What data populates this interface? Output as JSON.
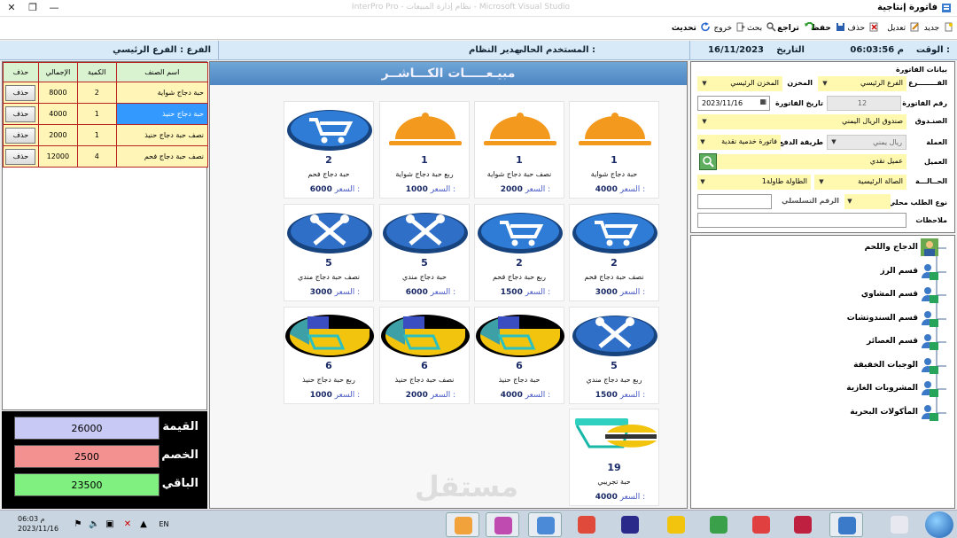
{
  "window": {
    "title": "فاتورة إنتاجية",
    "background_title": "InterPro Pro - نظام إدارة المبيعات - Microsoft Visual Studio",
    "controls": [
      "✕",
      "❐",
      "—"
    ]
  },
  "toolbar": {
    "items": [
      {
        "label": "جديد",
        "icon": "new-icon"
      },
      {
        "label": "تعديل",
        "icon": "edit-icon"
      },
      {
        "label": "حذف",
        "icon": "delete-icon"
      },
      {
        "label": "حفظ",
        "icon": "save-icon"
      },
      {
        "label": "تراجع",
        "icon": "undo-icon"
      },
      {
        "label": "بحث",
        "icon": "search-icon"
      },
      {
        "label": "خروج",
        "icon": "exit-icon"
      },
      {
        "label": "تحديث",
        "icon": "refresh-icon"
      }
    ]
  },
  "infobar": {
    "time_label": "الوقت :",
    "time_value": "06:03:56 م",
    "date_label": "التاريخ",
    "date_value": "16/11/2023",
    "user_label": "المستخدم الحالي :",
    "user_value": "مدير النظام",
    "branch_label": "الفرع :",
    "branch_value": "الفرع الرئيسي"
  },
  "cart": {
    "columns": {
      "name": "اسم الصنف",
      "qty": "الكمية",
      "total": "الإجمالي",
      "delete": "حذف"
    },
    "rows": [
      {
        "name": "حبة دجاج شواية",
        "qty": "2",
        "total": "8000",
        "delete": "حذف",
        "selected": false
      },
      {
        "name": "حبة دجاج حنيذ",
        "qty": "1",
        "total": "4000",
        "delete": "حذف",
        "selected": true
      },
      {
        "name": "نصف حبة دجاج حنيذ",
        "qty": "1",
        "total": "2000",
        "delete": "حذف",
        "selected": false
      },
      {
        "name": "نصف حبة دجاج فحم",
        "qty": "4",
        "total": "12000",
        "delete": "حذف",
        "selected": false
      }
    ]
  },
  "totals": {
    "value_label": "القيمة",
    "value": "26000",
    "discount_label": "الخصم",
    "discount": "2500",
    "remaining_label": "الباقي",
    "remaining": "23500",
    "colors": {
      "value": "#c9c9f6",
      "discount": "#f39090",
      "remaining": "#80f080"
    }
  },
  "sales": {
    "header": "مبيـعـــــات الكـــاشــر",
    "price_label": "السعر :",
    "items": [
      {
        "count": "1",
        "name": "حبة دجاج شواية",
        "price": "4000",
        "icon": "serving-dish-icon"
      },
      {
        "count": "1",
        "name": "نصف حبة دجاج شواية",
        "price": "2000",
        "icon": "serving-dish-icon"
      },
      {
        "count": "1",
        "name": "ربع حبة دجاج شواية",
        "price": "1000",
        "icon": "serving-dish-icon"
      },
      {
        "count": "2",
        "name": "حبة دجاج فحم",
        "price": "6000",
        "icon": "cart-icon"
      },
      {
        "count": "2",
        "name": "نصف حبة دجاج فحم",
        "price": "3000",
        "icon": "cart-icon"
      },
      {
        "count": "2",
        "name": "ربع حبة دجاج فحم",
        "price": "1500",
        "icon": "cart-icon"
      },
      {
        "count": "5",
        "name": "حبة دجاج مندي",
        "price": "6000",
        "icon": "tools-icon"
      },
      {
        "count": "5",
        "name": "نصف حبة دجاج مندي",
        "price": "3000",
        "icon": "tools-icon"
      },
      {
        "count": "5",
        "name": "ربع حبة دجاج مندي",
        "price": "1500",
        "icon": "tools-icon"
      },
      {
        "count": "6",
        "name": "حبة دجاج حنيذ",
        "price": "4000",
        "icon": "register-icon"
      },
      {
        "count": "6",
        "name": "نصف حبة دجاج حنيذ",
        "price": "2000",
        "icon": "register-icon"
      },
      {
        "count": "6",
        "name": "ربع حبة دجاج حنيذ",
        "price": "1000",
        "icon": "register-icon"
      },
      {
        "count": "19",
        "name": "حبة تجريبي",
        "price": "4000",
        "icon": "sandwich-icon"
      }
    ]
  },
  "invoice": {
    "section_title": "بيانات الفاتورة",
    "branch_label": "الفــــــــرع",
    "branch_value": "الفرع الرئيسي",
    "store_label": "المخزن",
    "store_value": "المخزن الرئيسي",
    "number_label": "رقم الفاتورة",
    "number_value": "12",
    "date_label": "تاريخ الفاتورة",
    "date_value": "2023/11/16",
    "cashbox_label": "الصنـدوق",
    "cashbox_value": "صندوق الريال اليمني",
    "currency_label": "العملة",
    "currency_value": "ريال يمني",
    "payment_label": "طريقة الدفع",
    "payment_value": "فاتورة خدمية نقدية",
    "customer_label": "العميل",
    "customer_value": "عميل نقدي",
    "status_label": "الحــالـــة",
    "status_value": "الصالة الرئيسية",
    "table_label": "الطاولة",
    "table_value": "الطاولة طاولة1",
    "order_type_label": "نوع الطلب",
    "order_type_value": "محلي",
    "serial_label": "الرقم التسلسلي",
    "serial_value": "",
    "notes_label": "ملاحظات",
    "notes_value": ""
  },
  "categories": [
    "الدجاج واللحم",
    "قسم الرز",
    "قسم المشاوي",
    "قسم السندوتشات",
    "قسم العصائر",
    "الوجبات الخفيفة",
    "المشروبات الغازية",
    "المأكولات البحرية"
  ],
  "watermark": "مستقل",
  "taskbar": {
    "time": "06:03 م",
    "date": "2023/11/16",
    "lang": "EN",
    "apps": [
      "windows-explorer-icon",
      "internet-explorer-icon",
      "media-icon",
      "chrome-like-icon",
      "grid-app-icon",
      "chrome-icon",
      "visual-studio-icon",
      "anydesk-icon",
      "sql-icon",
      "camera-icon",
      "database-icon",
      "screen-capture-icon"
    ]
  }
}
